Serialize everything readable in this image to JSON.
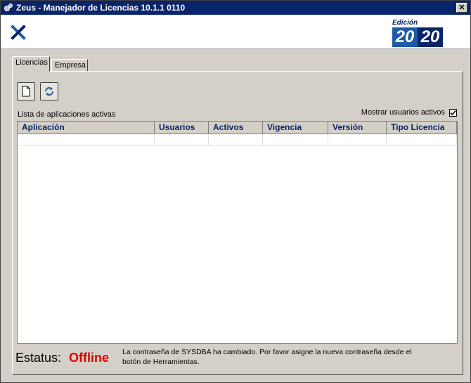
{
  "window": {
    "title": "Zeus - Manejador de Licencias 10.1.1 0110",
    "close_label": "✕"
  },
  "header": {
    "edition_label": "Edición",
    "edition_year_a": "20",
    "edition_year_b": "20"
  },
  "tabs": [
    {
      "label": "Licencias",
      "active": true
    },
    {
      "label": "Empresa",
      "active": false
    }
  ],
  "toolbar": {
    "new_icon": "new-document-icon",
    "refresh_icon": "refresh-icon"
  },
  "list": {
    "label": "Lista de aplicaciones activas",
    "show_active_label": "Mostrar usuarios activos",
    "show_active_checked": true,
    "columns": [
      "Aplicación",
      "Usuarios",
      "Activos",
      "Vigencia",
      "Versión",
      "Tipo Licencia"
    ]
  },
  "status": {
    "label": "Estatus:",
    "value": "Offline",
    "message": "La contraseña de SYSDBA ha cambiado. Por favor asigne la nueva contraseña desde el botón de Herramientas.",
    "value_color": "#e00000"
  }
}
